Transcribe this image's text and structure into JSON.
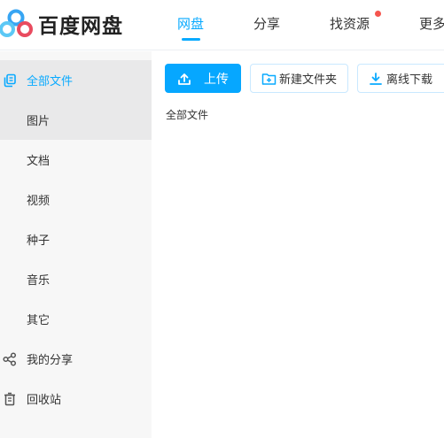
{
  "app": {
    "name": "百度网盘"
  },
  "nav": {
    "items": [
      {
        "label": "网盘",
        "active": true
      },
      {
        "label": "分享",
        "active": false
      },
      {
        "label": "找资源",
        "active": false,
        "badge": "red-dot"
      },
      {
        "label": "更多",
        "active": false
      }
    ]
  },
  "sidebar": {
    "items": [
      {
        "label": "全部文件",
        "icon": "copy-icon",
        "active": true
      },
      {
        "label": "图片"
      },
      {
        "label": "文档"
      },
      {
        "label": "视频"
      },
      {
        "label": "种子"
      },
      {
        "label": "音乐"
      },
      {
        "label": "其它"
      },
      {
        "label": "我的分享",
        "icon": "share-icon"
      },
      {
        "label": "回收站",
        "icon": "trash-icon"
      }
    ]
  },
  "toolbar": {
    "upload_label": "上传",
    "new_folder_label": "新建文件夹",
    "offline_download_label": "离线下载"
  },
  "breadcrumb": {
    "current": "全部文件"
  },
  "colors": {
    "accent": "#09aaff",
    "sidebar_bg": "#f7f7f7",
    "sidebar_active_bg": "#e9e9ea",
    "badge": "#f5554e"
  }
}
